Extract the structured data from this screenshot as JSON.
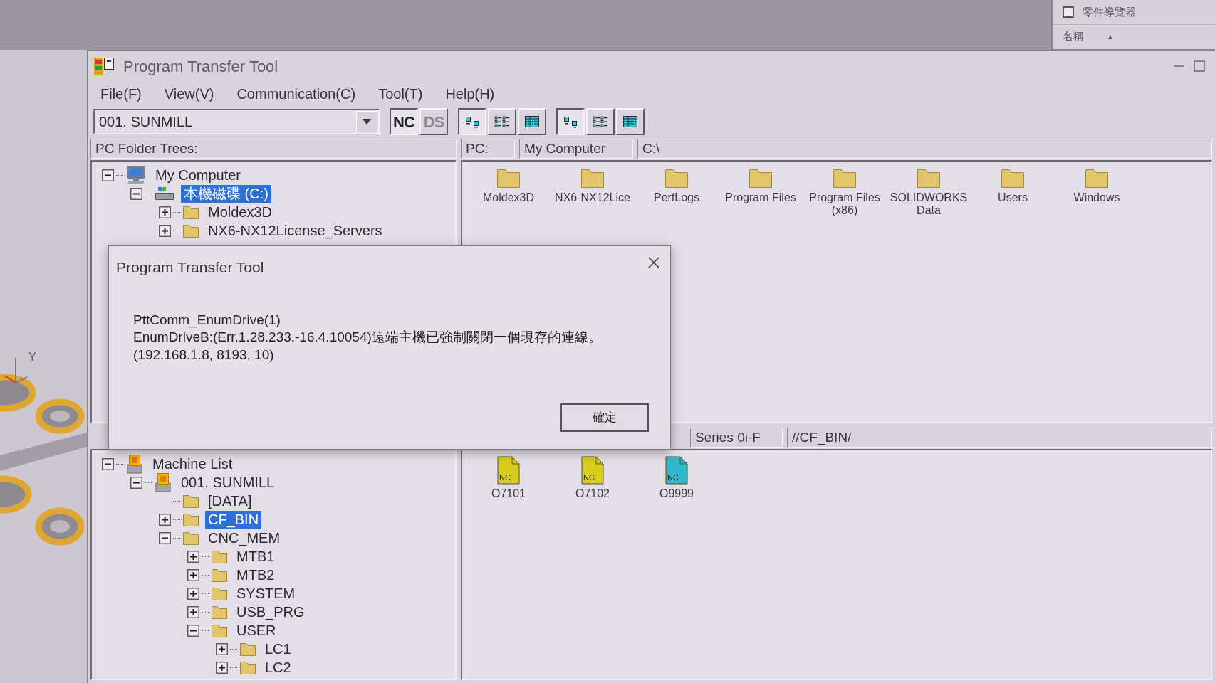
{
  "background_app": {
    "feature_panel": {
      "checkbox": {
        "label": "零件導覽器",
        "checked": false
      },
      "column_header": {
        "label": "名稱",
        "sort_indicator": "▲"
      }
    },
    "viewport": {
      "axis_label": "Y"
    }
  },
  "window": {
    "title": "Program Transfer Tool"
  },
  "menu": [
    "File(F)",
    "View(V)",
    "Communication(C)",
    "Tool(T)",
    "Help(H)"
  ],
  "toolbar": {
    "machine_select": {
      "value": "001. SUNMILL"
    },
    "mode_buttons": [
      {
        "label": "NC",
        "selected": true
      },
      {
        "label": "DS",
        "selected": false
      }
    ],
    "pc_view_buttons": [
      {
        "kind": "large",
        "selected": true
      },
      {
        "kind": "list",
        "selected": false
      },
      {
        "kind": "details",
        "selected": false
      }
    ],
    "cnc_view_buttons": [
      {
        "kind": "large",
        "selected": true
      },
      {
        "kind": "list",
        "selected": false
      },
      {
        "kind": "details",
        "selected": false
      }
    ]
  },
  "pc_panel": {
    "tree_header": "PC Folder Trees:",
    "path_bar": [
      "PC:",
      "My Computer",
      "C:\\"
    ],
    "tree": [
      {
        "label": "My Computer",
        "kind": "computer",
        "expanded": true,
        "selected": false,
        "children": [
          {
            "label": "本機磁碟 (C:)",
            "kind": "drive",
            "expanded": true,
            "selected": true,
            "children": [
              {
                "label": "Moldex3D",
                "kind": "folder",
                "expanded": false,
                "selected": false
              },
              {
                "label": "NX6-NX12License_Servers",
                "kind": "folder",
                "expanded": false,
                "selected": false
              }
            ]
          }
        ]
      }
    ],
    "folders": [
      {
        "label": "Moldex3D"
      },
      {
        "label": "NX6-NX12Lice"
      },
      {
        "label": "PerfLogs"
      },
      {
        "label": "Program Files"
      },
      {
        "label": "Program Files (x86)"
      },
      {
        "label": "SOLIDWORKS Data"
      },
      {
        "label": "Users"
      },
      {
        "label": "Windows"
      }
    ]
  },
  "cnc_panel": {
    "path_bar": [
      "Series 0i-F",
      "//CF_BIN/"
    ],
    "tree": [
      {
        "label": "Machine List",
        "kind": "machine",
        "expanded": true,
        "selected": false,
        "children": [
          {
            "label": "001. SUNMILL",
            "kind": "machine",
            "expanded": true,
            "selected": false,
            "children": [
              {
                "label": "[DATA]",
                "kind": "folder",
                "selected": false
              },
              {
                "label": "CF_BIN",
                "kind": "folder",
                "expanded": false,
                "selected": true
              },
              {
                "label": "CNC_MEM",
                "kind": "folder",
                "expanded": true,
                "selected": false,
                "children": [
                  {
                    "label": "MTB1",
                    "kind": "folder",
                    "expanded": false,
                    "selected": false
                  },
                  {
                    "label": "MTB2",
                    "kind": "folder",
                    "expanded": false,
                    "selected": false
                  },
                  {
                    "label": "SYSTEM",
                    "kind": "folder",
                    "expanded": false,
                    "selected": false
                  },
                  {
                    "label": "USB_PRG",
                    "kind": "folder",
                    "expanded": false,
                    "selected": false
                  },
                  {
                    "label": "USER",
                    "kind": "folder",
                    "expanded": true,
                    "selected": false,
                    "children": [
                      {
                        "label": "LC1",
                        "kind": "folder",
                        "expanded": false,
                        "selected": false
                      },
                      {
                        "label": "LC2",
                        "kind": "folder",
                        "expanded": false,
                        "selected": false
                      }
                    ]
                  }
                ]
              }
            ]
          }
        ]
      }
    ],
    "files": [
      {
        "label": "O7101",
        "icon_text": "NC",
        "color": "#d8cd1c"
      },
      {
        "label": "O7102",
        "icon_text": "NC",
        "color": "#d8cd1c"
      },
      {
        "label": "O9999",
        "icon_text": "NC",
        "color": "#2fb8cc"
      }
    ]
  },
  "dialog": {
    "title": "Program Transfer Tool",
    "message": [
      "PttComm_EnumDrive(1)",
      "EnumDriveB:(Err.1.28.233.-16.4.10054)遠端主機已強制關閉一個現存的連線。",
      "(192.168.1.8, 8193, 10)"
    ],
    "buttons": [
      "確定"
    ]
  }
}
